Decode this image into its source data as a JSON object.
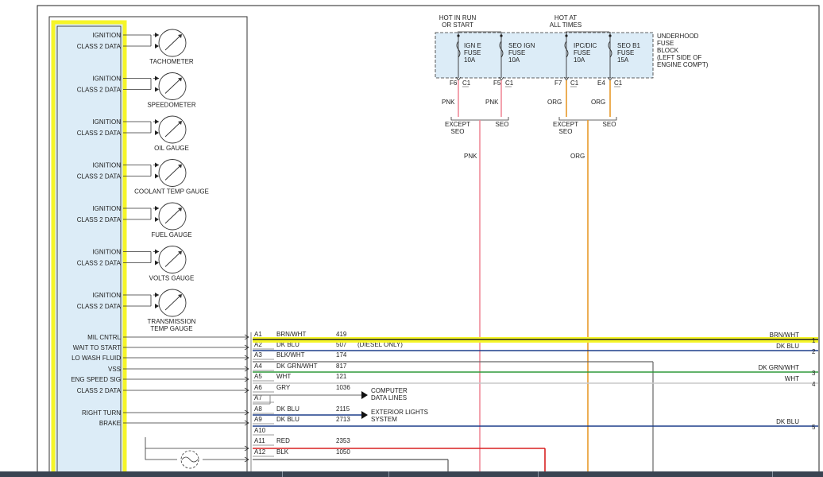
{
  "gauge_group": {
    "pin_labels": [
      "IGNITION",
      "CLASS 2 DATA"
    ],
    "gauges": [
      {
        "name": [
          "TACHOMETER"
        ]
      },
      {
        "name": [
          "SPEEDOMETER"
        ]
      },
      {
        "name": [
          "OIL GAUGE"
        ]
      },
      {
        "name": [
          "COOLANT TEMP GAUGE"
        ]
      },
      {
        "name": [
          "FUEL GAUGE"
        ]
      },
      {
        "name": [
          "VOLTS GAUGE"
        ]
      },
      {
        "name": [
          "TRANSMISSION",
          "TEMP GAUGE"
        ]
      }
    ]
  },
  "fuse_block": {
    "hot_in_run": [
      "HOT IN RUN",
      "OR START"
    ],
    "hot_at_all": [
      "HOT AT",
      "ALL TIMES"
    ],
    "label": [
      "UNDERHOOD",
      "FUSE",
      "BLOCK",
      "(LEFT SIDE OF",
      "ENGINE COMPT)"
    ],
    "fuses": [
      {
        "name": [
          "IGN E",
          "FUSE",
          "10A"
        ],
        "pin": "F6",
        "conn": "C1",
        "wire": "PNK",
        "note": [
          "EXCEPT",
          "SEO"
        ],
        "color": "#f08a9a"
      },
      {
        "name": [
          "SEO IGN",
          "FUSE",
          "10A"
        ],
        "pin": "F5",
        "conn": "C1",
        "wire": "PNK",
        "note": [
          "SEO"
        ],
        "color": "#f08a9a"
      },
      {
        "name": [
          "IPC/DIC",
          "FUSE",
          "10A"
        ],
        "pin": "F7",
        "conn": "C1",
        "wire": "ORG",
        "note": [
          "EXCEPT",
          "SEO"
        ],
        "color": "#e89a2a"
      },
      {
        "name": [
          "SEO B1",
          "FUSE",
          "15A"
        ],
        "pin": "E4",
        "conn": "C1",
        "wire": "ORG",
        "note": [
          "SEO"
        ],
        "color": "#e89a2a"
      }
    ],
    "merged_wires": [
      "PNK",
      "ORG"
    ]
  },
  "connector": {
    "left_labels": [
      "MIL CNTRL",
      "WAIT TO START",
      "LO WASH FLUID",
      "VSS",
      "ENG SPEED SIG",
      "CLASS 2 DATA",
      "RIGHT TURN",
      "BRAKE"
    ],
    "pins": [
      {
        "pin": "A1",
        "color": "BRN/WHT",
        "circuit": "419",
        "right_label": "BRN/WHT",
        "num": "1",
        "stroke": "#c8a44a"
      },
      {
        "pin": "A2",
        "color": "DK BLU",
        "circuit": "507",
        "extra": "(DIESEL ONLY)",
        "right_label": "DK BLU",
        "num": "2",
        "stroke": "#1d3f8a"
      },
      {
        "pin": "A3",
        "color": "BLK/WHT",
        "circuit": "174",
        "stroke": "#777777"
      },
      {
        "pin": "A4",
        "color": "DK GRN/WHT",
        "circuit": "817",
        "right_label": "DK GRN/WHT",
        "num": "3",
        "stroke": "#2e9a3a"
      },
      {
        "pin": "A5",
        "color": "WHT",
        "circuit": "121",
        "right_label": "WHT",
        "num": "4",
        "stroke": "#c8c8c8"
      },
      {
        "pin": "A6",
        "color": "GRY",
        "circuit": "1036",
        "stroke": "#888888"
      },
      {
        "pin": "A7"
      },
      {
        "pin": "A8",
        "color": "DK BLU",
        "circuit": "2115",
        "stroke": "#1d3f8a"
      },
      {
        "pin": "A9",
        "color": "DK BLU",
        "circuit": "2713",
        "right_label": "DK BLU",
        "num": "5",
        "stroke": "#1d3f8a"
      },
      {
        "pin": "A10"
      },
      {
        "pin": "A11",
        "color": "RED",
        "circuit": "2353",
        "stroke": "#d82020"
      },
      {
        "pin": "A12",
        "color": "BLK",
        "circuit": "1050",
        "stroke": "#555555"
      }
    ],
    "computer_data": [
      "COMPUTER",
      "DATA LINES"
    ],
    "exterior_lights": [
      "EXTERIOR LIGHTS",
      "SYSTEM"
    ]
  }
}
